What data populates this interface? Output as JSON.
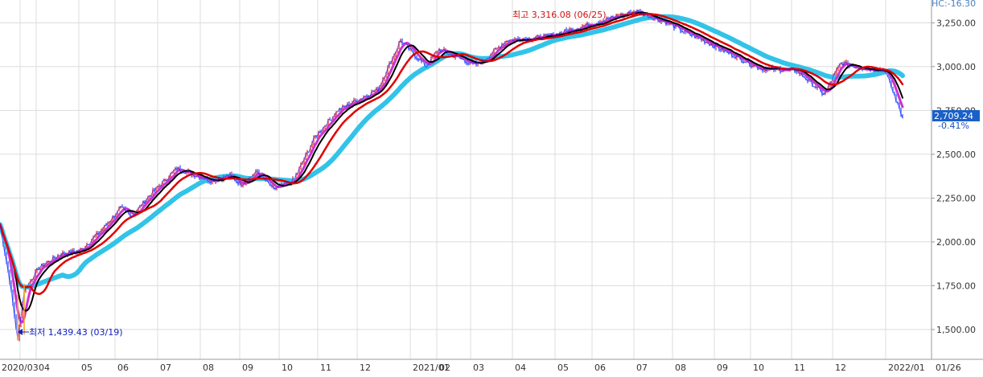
{
  "chart_data": {
    "type": "line",
    "title": "",
    "xlabel": "",
    "ylabel": "",
    "ylim": [
      1330,
      3380
    ],
    "grid": true,
    "y_ticks": [
      "3,250.00",
      "3,000.00",
      "2,750.00",
      "2,500.00",
      "2,250.00",
      "2,000.00",
      "1,750.00",
      "1,500.00"
    ],
    "y_tick_values": [
      3250,
      3000,
      2750,
      2500,
      2250,
      2000,
      1750,
      1500
    ],
    "x_ticks": [
      "2020/03",
      "04",
      "05",
      "06",
      "07",
      "08",
      "09",
      "10",
      "11",
      "12",
      "2021/01",
      "02",
      "03",
      "04",
      "05",
      "06",
      "07",
      "08",
      "09",
      "10",
      "11",
      "12",
      "2022/01"
    ],
    "date_labels": [
      "01/26"
    ],
    "top_right_label": "HC:-16.30",
    "current_value": {
      "value": "2,709.24",
      "change": "-0.41%"
    },
    "annotations": {
      "high": {
        "text": "최고 3,316.08 (06/25)",
        "value": 3316.08,
        "date": "06/25"
      },
      "low": {
        "text": "최저 1,439.43 (03/19)",
        "value": 1439.43,
        "date": "03/19"
      }
    },
    "price_points": [
      [
        "2020/03 start",
        2100
      ],
      [
        "2020/03",
        1780
      ],
      [
        "03/19",
        1439.43
      ],
      [
        "03 end",
        1720
      ],
      [
        "04",
        1850
      ],
      [
        "04 end",
        1930
      ],
      [
        "05",
        1950
      ],
      [
        "06",
        2060
      ],
      [
        "06 peak",
        2190
      ],
      [
        "07",
        2150
      ],
      [
        "07 end",
        2260
      ],
      [
        "08",
        2420
      ],
      [
        "08 end",
        2350
      ],
      [
        "09",
        2380
      ],
      [
        "09 end",
        2330
      ],
      [
        "10",
        2400
      ],
      [
        "10 end",
        2300
      ],
      [
        "11",
        2350
      ],
      [
        "11 end",
        2600
      ],
      [
        "12",
        2750
      ],
      [
        "12 end",
        2870
      ],
      [
        "2021/01",
        3150
      ],
      [
        "01 end",
        3000
      ],
      [
        "02",
        3100
      ],
      [
        "02 end",
        3010
      ],
      [
        "03",
        3030
      ],
      [
        "04",
        3150
      ],
      [
        "05",
        3170
      ],
      [
        "06",
        3250
      ],
      [
        "06/25",
        3316.08
      ],
      [
        "07",
        3250
      ],
      [
        "08",
        3200
      ],
      [
        "08 end",
        3150
      ],
      [
        "09",
        3080
      ],
      [
        "10",
        2990
      ],
      [
        "11",
        2980
      ],
      [
        "11 end",
        2840
      ],
      [
        "12",
        3020
      ],
      [
        "12 end",
        2990
      ],
      [
        "2022/01",
        2980
      ],
      [
        "01/26",
        2709.24
      ]
    ],
    "series": [
      {
        "color": "#1a1aff",
        "role": "price"
      },
      {
        "color": "#000000",
        "role": "moving average 1"
      },
      {
        "color": "#e00000",
        "role": "moving average 2"
      },
      {
        "color": "#cc33cc",
        "role": "moving average 3"
      },
      {
        "color": "#33c3e8",
        "role": "moving average 4"
      }
    ]
  }
}
